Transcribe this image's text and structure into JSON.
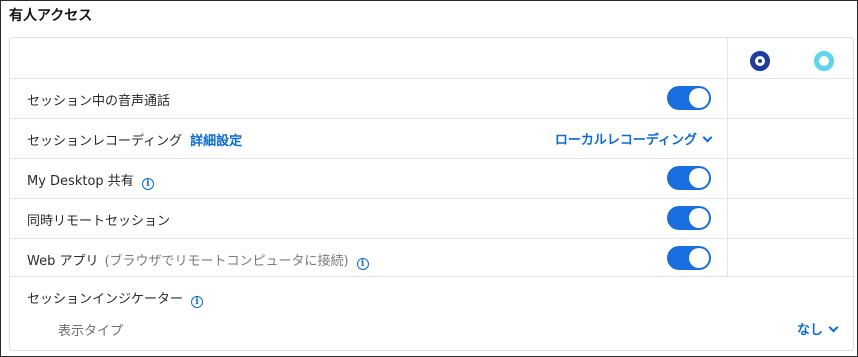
{
  "section": {
    "title": "有人アクセス"
  },
  "columns": {
    "icon1": "target-dark-icon",
    "icon2": "target-light-icon"
  },
  "rows": [
    {
      "label": "セッション中の音声通話",
      "toggle": true
    },
    {
      "label": "セッションレコーディング",
      "link": "詳細設定",
      "dropdown": "ローカルレコーディング"
    },
    {
      "label": "My Desktop 共有",
      "info": true,
      "toggle": true
    },
    {
      "label": "同時リモートセッション",
      "toggle": true
    },
    {
      "label": "Web アプリ",
      "note": "(ブラウザでリモートコンピュータに接続)",
      "info": true,
      "toggle": true
    }
  ],
  "indicator": {
    "label": "セッションインジケーター",
    "sub_label": "表示タイプ",
    "value": "なし"
  },
  "colors": {
    "accent": "#1a6fe0",
    "link": "#0b6bd3",
    "icon_dark": "#1c3f9e",
    "icon_light": "#5fd4ea"
  }
}
